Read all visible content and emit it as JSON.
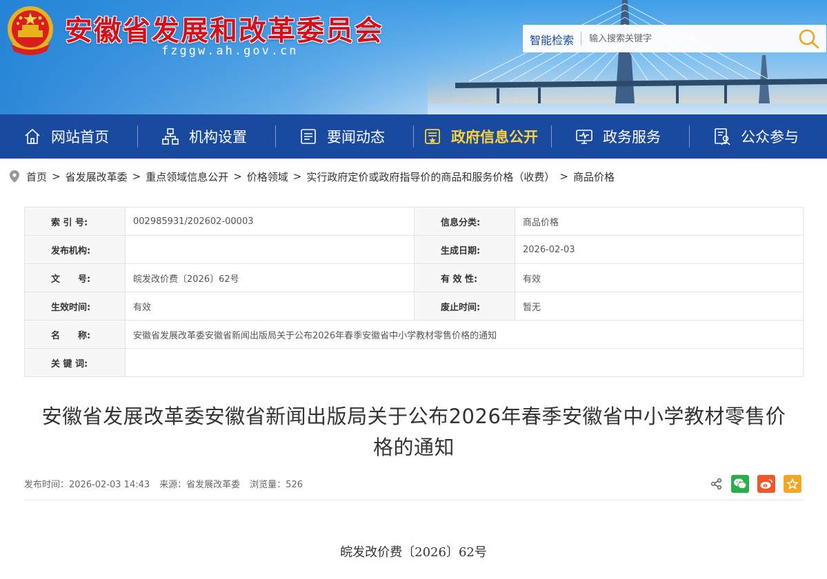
{
  "header": {
    "site_title": "安徽省发展和改革委员会",
    "site_domain": "fzggw.ah.gov.cn",
    "search": {
      "label": "智能检索",
      "placeholder": "输入搜索关键字"
    }
  },
  "nav": {
    "items": [
      {
        "label": "网站首页",
        "icon": "home-icon"
      },
      {
        "label": "机构设置",
        "icon": "org-chart-icon"
      },
      {
        "label": "要闻动态",
        "icon": "news-icon"
      },
      {
        "label": "政府信息公开",
        "icon": "info-disclosure-icon",
        "active": true
      },
      {
        "label": "政务服务",
        "icon": "monitor-icon"
      },
      {
        "label": "公众参与",
        "icon": "participation-icon"
      }
    ],
    "active_color": "#ffd43b",
    "bg_color": "#1a4aa0"
  },
  "breadcrumb": [
    "首页",
    "省发展改革委",
    "重点领域信息公开",
    "价格领域",
    "实行政府定价或政府指导价的商品和服务价格（收费）",
    "商品价格"
  ],
  "meta": {
    "index_label": "索 引 号:",
    "index_value": "002985931/202602-00003",
    "category_label": "信息分类:",
    "category_value": "商品价格",
    "publisher_label": "发布机构:",
    "publisher_value": "",
    "date_label": "生成日期:",
    "date_value": "2026-02-03",
    "docno_label": "文　　号:",
    "docno_value": "皖发改价费〔2026〕62号",
    "validity_label": "有 效 性:",
    "validity_value": "有效",
    "effective_label": "生效时间:",
    "effective_value": "有效",
    "repeal_label": "废止时间:",
    "repeal_value": "暂无",
    "name_label": "名　　称:",
    "name_value": "安徽省发展改革委安徽省新闻出版局关于公布2026年春季安徽省中小学教材零售价格的通知",
    "keywords_label": "关 键 词:",
    "keywords_value": ""
  },
  "article": {
    "title": "安徽省发展改革委安徽省新闻出版局关于公布2026年春季安徽省中小学教材零售价格的通知",
    "publish_time": "发布时间：2026-02-03 14:43",
    "source": "来源：省发展改革委",
    "views": "浏览量：526",
    "doc_number": "皖发改价费〔2026〕62号"
  },
  "share": {
    "icons": [
      "share-icon",
      "wechat-icon",
      "weibo-icon",
      "favorite-icon"
    ],
    "colors": {
      "wechat": "#2aae47",
      "weibo": "#f0572b",
      "favorite": "#f5a623"
    }
  }
}
